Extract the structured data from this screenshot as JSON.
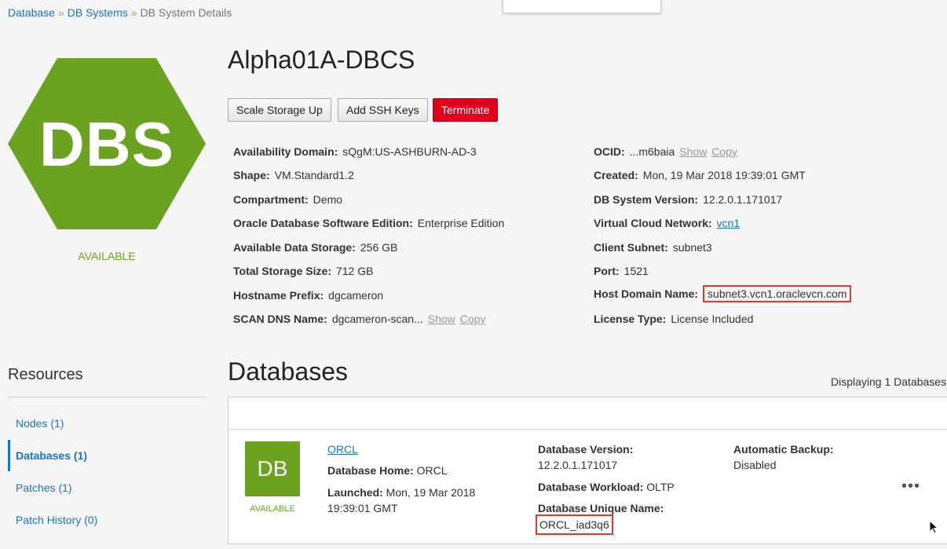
{
  "breadcrumb": {
    "database": "Database",
    "sep1": "»",
    "db_systems": "DB Systems",
    "sep2": "»",
    "current": "DB System Details"
  },
  "hero": {
    "icon_label": "DBS",
    "status": "AVAILABLE",
    "hex_color": "#6aa31f"
  },
  "title": "Alpha01A-DBCS",
  "actions": {
    "scale": "Scale Storage Up",
    "ssh": "Add SSH Keys",
    "terminate": "Terminate"
  },
  "details_left": [
    {
      "key": "Availability Domain:",
      "value": "sQgM:US-ASHBURN-AD-3"
    },
    {
      "key": "Shape:",
      "value": "VM.Standard1.2"
    },
    {
      "key": "Compartment:",
      "value": "Demo"
    },
    {
      "key": "Oracle Database Software Edition:",
      "value": "Enterprise Edition"
    },
    {
      "key": "Available Data Storage:",
      "value": "256 GB"
    },
    {
      "key": "Total Storage Size:",
      "value": "712 GB"
    },
    {
      "key": "Hostname Prefix:",
      "value": "dgcameron"
    },
    {
      "key": "SCAN DNS Name:",
      "value": "dgcameron-scan...",
      "show": "Show",
      "copy": "Copy"
    }
  ],
  "details_right": [
    {
      "key": "OCID:",
      "value": "...m6baia",
      "show": "Show",
      "copy": "Copy"
    },
    {
      "key": "Created:",
      "value": "Mon, 19 Mar 2018 19:39:01 GMT"
    },
    {
      "key": "DB System Version:",
      "value": "12.2.0.1.171017"
    },
    {
      "key": "Virtual Cloud Network:",
      "value": "vcn1"
    },
    {
      "key": "Client Subnet:",
      "value": "subnet3"
    },
    {
      "key": "Port:",
      "value": "1521"
    },
    {
      "key": "Host Domain Name:",
      "value": "subnet3.vcn1.oraclevcn.com"
    },
    {
      "key": "License Type:",
      "value": "License Included"
    }
  ],
  "resources": {
    "title": "Resources",
    "items": [
      {
        "label": "Nodes (1)"
      },
      {
        "label": "Databases (1)"
      },
      {
        "label": "Patches (1)"
      },
      {
        "label": "Patch History (0)"
      }
    ]
  },
  "databases": {
    "heading": "Databases",
    "count_text": "Displaying 1 Databases",
    "row": {
      "badge": "DB",
      "status": "AVAILABLE",
      "name": "ORCL",
      "home_key": "Database Home:",
      "home_value": "ORCL",
      "launched_key": "Launched:",
      "launched_value_1": "Mon, 19 Mar 2018",
      "launched_value_2": "19:39:01 GMT",
      "version_key": "Database Version:",
      "version_value": "12.2.0.1.171017",
      "workload_key": "Database Workload:",
      "workload_value": "OLTP",
      "unique_key": "Database Unique Name:",
      "unique_value": "ORCL_iad3q6",
      "backup_key": "Automatic Backup:",
      "backup_value": "Disabled",
      "more": "•••"
    }
  }
}
